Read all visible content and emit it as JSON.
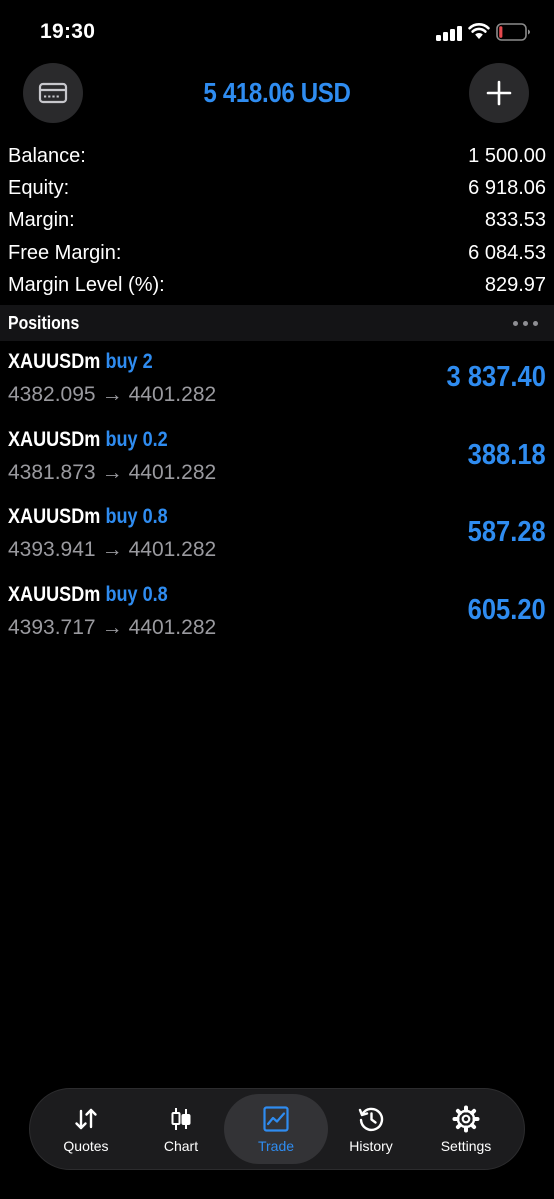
{
  "status_bar": {
    "time": "19:30"
  },
  "header": {
    "balance": "5 418.06 USD"
  },
  "summary": [
    {
      "label": "Balance:",
      "value": "1 500.00"
    },
    {
      "label": "Equity:",
      "value": "6 918.06"
    },
    {
      "label": "Margin:",
      "value": "833.53"
    },
    {
      "label": "Free Margin:",
      "value": "6 084.53"
    },
    {
      "label": "Margin Level (%):",
      "value": "829.97"
    }
  ],
  "positions": {
    "title": "Positions",
    "items": [
      {
        "symbol": "XAUUSDm",
        "side": "buy 2",
        "open": "4382.095",
        "arrow": "→",
        "current": "4401.282",
        "profit": "3 837.40"
      },
      {
        "symbol": "XAUUSDm",
        "side": "buy 0.2",
        "open": "4381.873",
        "arrow": "→",
        "current": "4401.282",
        "profit": "388.18"
      },
      {
        "symbol": "XAUUSDm",
        "side": "buy 0.8",
        "open": "4393.941",
        "arrow": "→",
        "current": "4401.282",
        "profit": "587.28"
      },
      {
        "symbol": "XAUUSDm",
        "side": "buy 0.8",
        "open": "4393.717",
        "arrow": "→",
        "current": "4401.282",
        "profit": "605.20"
      }
    ]
  },
  "tabs": [
    {
      "label": "Quotes",
      "icon": "quotes-icon",
      "active": false
    },
    {
      "label": "Chart",
      "icon": "chart-icon",
      "active": false
    },
    {
      "label": "Trade",
      "icon": "trade-icon",
      "active": true
    },
    {
      "label": "History",
      "icon": "history-icon",
      "active": false
    },
    {
      "label": "Settings",
      "icon": "settings-icon",
      "active": false
    }
  ],
  "colors": {
    "accent": "#2f8cf0",
    "background": "#000000",
    "muted_text": "#9a9a9f",
    "battery_low": "#e5484d"
  }
}
